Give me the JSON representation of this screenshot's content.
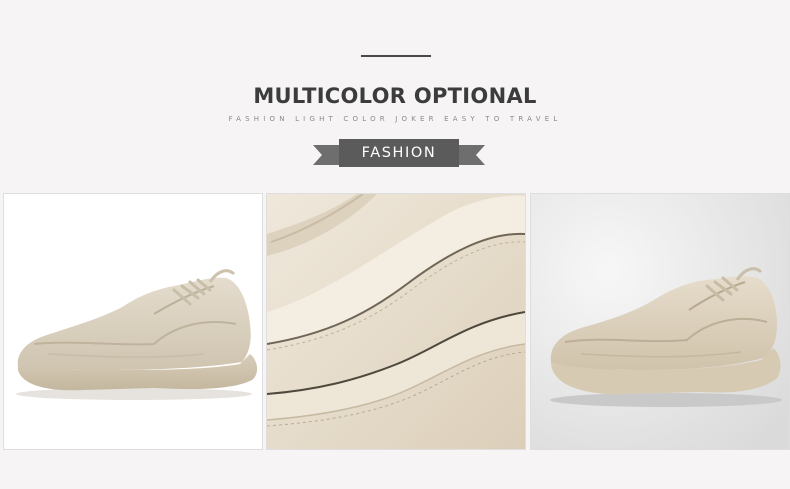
{
  "header": {
    "title": "MULTICOLOR OPTIONAL",
    "subtitle": "FASHION LIGHT COLOR JOKER EASY TO TRAVEL",
    "badge_label": "FASHION"
  },
  "colors": {
    "background": "#f6f4f5",
    "title_text": "#3c3c3c",
    "subtitle_text": "#8a8a8a",
    "ribbon": "#5b5b5b",
    "ribbon_tails": "#6e6e6e",
    "shoe_beige": "#ddd3c2",
    "sole_beige": "#d2c6b0"
  },
  "gallery": {
    "images": [
      {
        "name": "sneaker-side-view-white-background"
      },
      {
        "name": "sneaker-leather-closeup"
      },
      {
        "name": "sneaker-side-view-gray-background"
      }
    ]
  }
}
